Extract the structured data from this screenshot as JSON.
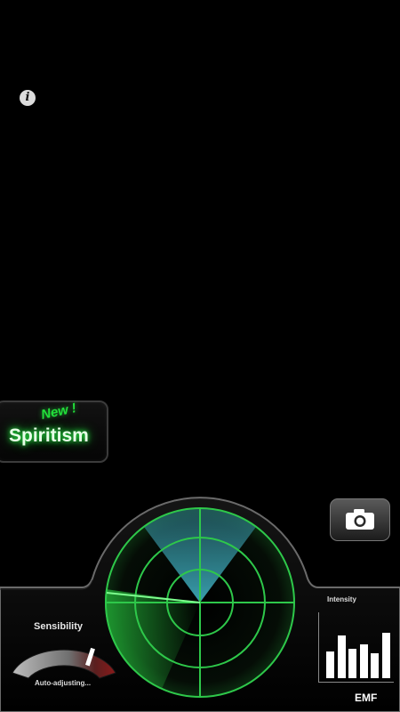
{
  "info": {
    "glyph": "i"
  },
  "spiritism": {
    "badge": "New !",
    "label": "Spiritism",
    "accent": "#22e03a"
  },
  "camera": {
    "icon": "camera-icon"
  },
  "sensibility": {
    "title": "Sensibility",
    "status": "Auto-adjusting..."
  },
  "intensity": {
    "title": "Intensity",
    "bars": [
      0.45,
      0.72,
      0.5,
      0.58,
      0.42,
      0.78
    ]
  },
  "emf": {
    "label": "EMF"
  },
  "colors": {
    "radar": "#2ec84a",
    "sweep": "#3fb0c0",
    "background": "#000000"
  }
}
